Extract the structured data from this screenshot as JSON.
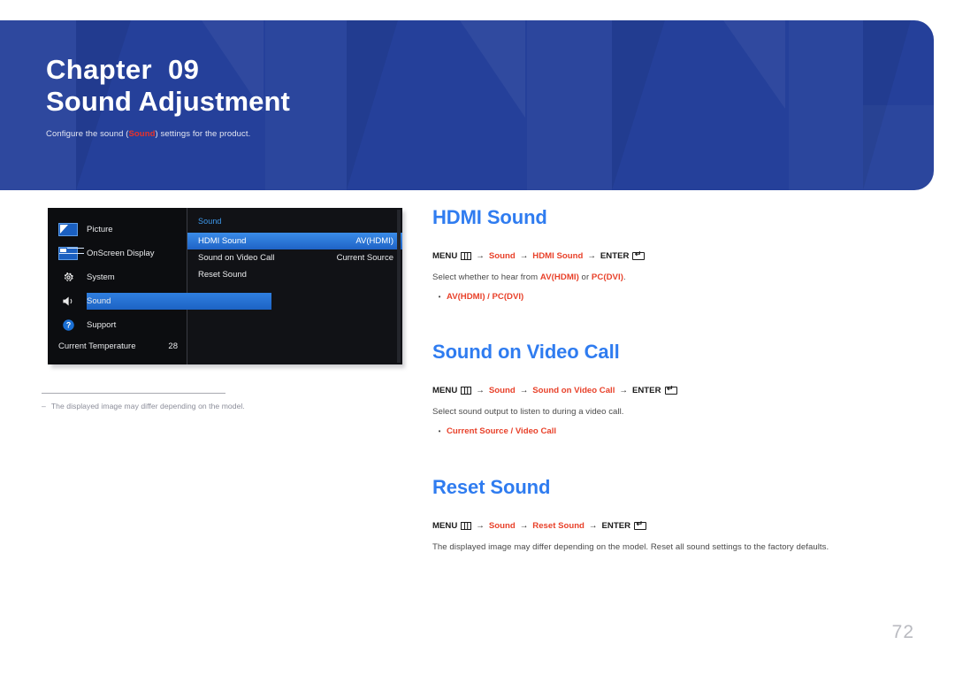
{
  "banner": {
    "chapter_label": "Chapter  09",
    "chapter_title": "Sound Adjustment",
    "subtitle_before": "Configure the sound (",
    "subtitle_highlight": "Sound",
    "subtitle_after": ") settings for the product.",
    "bg_color": "#25409a",
    "highlight_color": "#e8322a"
  },
  "osd": {
    "left_panel": {
      "items": [
        {
          "label": "Picture",
          "icon": "picture-icon",
          "selected": false
        },
        {
          "label": "OnScreen Display",
          "icon": "onscreen-display-icon",
          "selected": false
        },
        {
          "label": "System",
          "icon": "gear-icon",
          "selected": false
        },
        {
          "label": "Sound",
          "icon": "speaker-icon",
          "selected": true
        },
        {
          "label": "Support",
          "icon": "question-mark-icon",
          "selected": false
        }
      ],
      "temperature_label": "Current Temperature",
      "temperature_value": "28"
    },
    "right_panel": {
      "title": "Sound",
      "rows": [
        {
          "label": "HDMI Sound",
          "value": "AV(HDMI)",
          "selected": true
        },
        {
          "label": "Sound on Video Call",
          "value": "Current Source",
          "selected": false
        },
        {
          "label": "Reset Sound",
          "value": "",
          "selected": false
        }
      ]
    },
    "highlight_color": "#2f7fe0",
    "title_color": "#3e9bf0"
  },
  "footnote": {
    "dash": "–",
    "text": "The displayed image may differ depending on the model."
  },
  "sections": [
    {
      "title": "HDMI Sound",
      "crumb": {
        "menu_label": "MENU",
        "menu_icon": "menu-grid-icon",
        "arrow": "→",
        "path1": "Sound",
        "path2": "HDMI Sound",
        "enter_label": "ENTER",
        "enter_icon": "enter-key-icon"
      },
      "body_before": "Select whether to hear from ",
      "body_bold1": "AV(HDMI)",
      "body_mid": " or ",
      "body_bold2": "PC(DVI)",
      "body_after": ".",
      "bullet_dot": "•",
      "bullet_text": "AV(HDMI) / PC(DVI)"
    },
    {
      "title": "Sound on Video Call",
      "crumb": {
        "menu_label": "MENU",
        "menu_icon": "menu-grid-icon",
        "arrow": "→",
        "path1": "Sound",
        "path2": "Sound on Video Call",
        "enter_label": "ENTER",
        "enter_icon": "enter-key-icon"
      },
      "body_before": "Select sound output to listen to during a video call.",
      "body_bold1": "",
      "body_mid": "",
      "body_bold2": "",
      "body_after": "",
      "bullet_dot": "•",
      "bullet_text": "Current Source / Video Call"
    },
    {
      "title": "Reset Sound",
      "crumb": {
        "menu_label": "MENU",
        "menu_icon": "menu-grid-icon",
        "arrow": "→",
        "path1": "Sound",
        "path2": "Reset Sound",
        "enter_label": "ENTER",
        "enter_icon": "enter-key-icon"
      },
      "body_before": "The displayed image may differ depending on the model. Reset all sound settings to the factory defaults.",
      "body_bold1": "",
      "body_mid": "",
      "body_bold2": "",
      "body_after": "",
      "bullet_dot": "",
      "bullet_text": ""
    }
  ],
  "page_number": "72",
  "accent_blue": "#2f7cf0",
  "accent_red": "#e8412a"
}
